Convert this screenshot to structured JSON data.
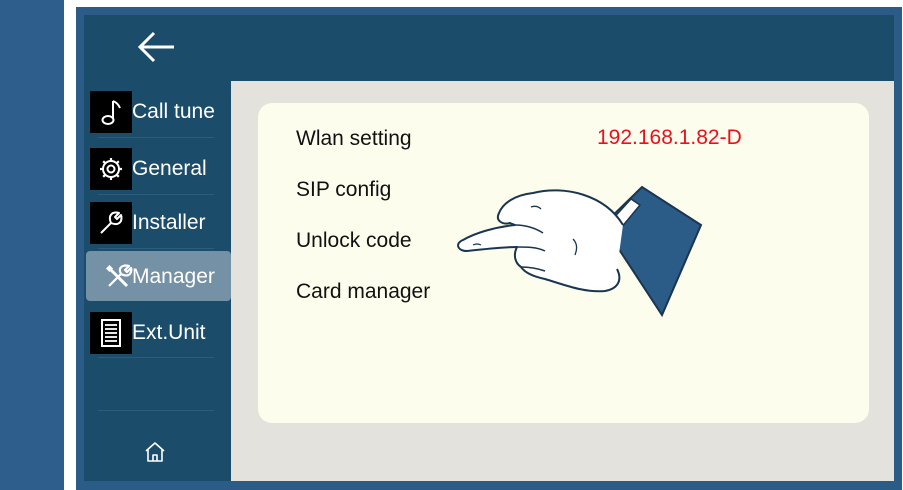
{
  "header": {
    "back_icon": "arrow-left-icon"
  },
  "sidebar": {
    "items": [
      {
        "label": "Call tune",
        "icon": "music-note-icon"
      },
      {
        "label": "General",
        "icon": "gear-icon"
      },
      {
        "label": "Installer",
        "icon": "wrench-icon"
      },
      {
        "label": "Manager",
        "icon": "tools-icon",
        "active": true
      },
      {
        "label": "Ext.Unit",
        "icon": "document-list-icon"
      }
    ],
    "home_icon": "home-icon"
  },
  "menu": {
    "items": [
      "Wlan setting",
      "SIP config",
      "Unlock code",
      "Card manager"
    ],
    "ip_address": "192.168.1.82-D"
  },
  "colors": {
    "header_bg": "#1b4c69",
    "active_item_bg": "#7591a6",
    "card_bg": "#fdfdee",
    "ip_text": "#e8111b"
  }
}
